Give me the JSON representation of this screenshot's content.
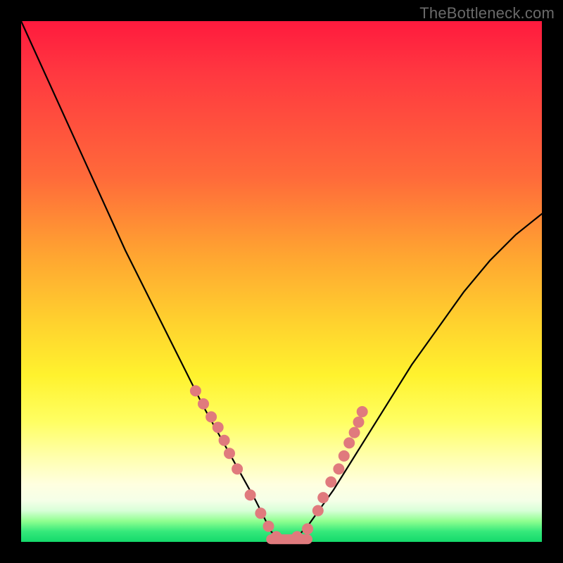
{
  "watermark": "TheBottleneck.com",
  "chart_data": {
    "type": "line",
    "title": "",
    "xlabel": "",
    "ylabel": "",
    "xlim": [
      0,
      100
    ],
    "ylim": [
      0,
      100
    ],
    "series": [
      {
        "name": "bottleneck-curve",
        "x": [
          0,
          5,
          10,
          15,
          20,
          25,
          30,
          35,
          40,
          45,
          48,
          50,
          52,
          55,
          60,
          65,
          70,
          75,
          80,
          85,
          90,
          95,
          100
        ],
        "y": [
          100,
          89,
          78,
          67,
          56,
          46,
          36,
          26,
          17,
          8,
          2,
          0,
          0,
          3,
          10,
          18,
          26,
          34,
          41,
          48,
          54,
          59,
          63
        ]
      }
    ],
    "flat_range_x": [
      48,
      55
    ],
    "markers": {
      "name": "data-points",
      "color": "#e07a7d",
      "x": [
        33.5,
        35.0,
        36.5,
        37.8,
        39.0,
        40.0,
        41.5,
        44.0,
        46.0,
        47.5,
        49.0,
        53.0,
        55.0,
        57.0,
        58.0,
        59.5,
        61.0,
        62.0,
        63.0,
        64.0,
        64.8,
        65.5
      ],
      "y": [
        29.0,
        26.5,
        24.0,
        22.0,
        19.5,
        17.0,
        14.0,
        9.0,
        5.5,
        3.0,
        1.0,
        1.0,
        2.5,
        6.0,
        8.5,
        11.5,
        14.0,
        16.5,
        19.0,
        21.0,
        23.0,
        25.0
      ]
    }
  }
}
